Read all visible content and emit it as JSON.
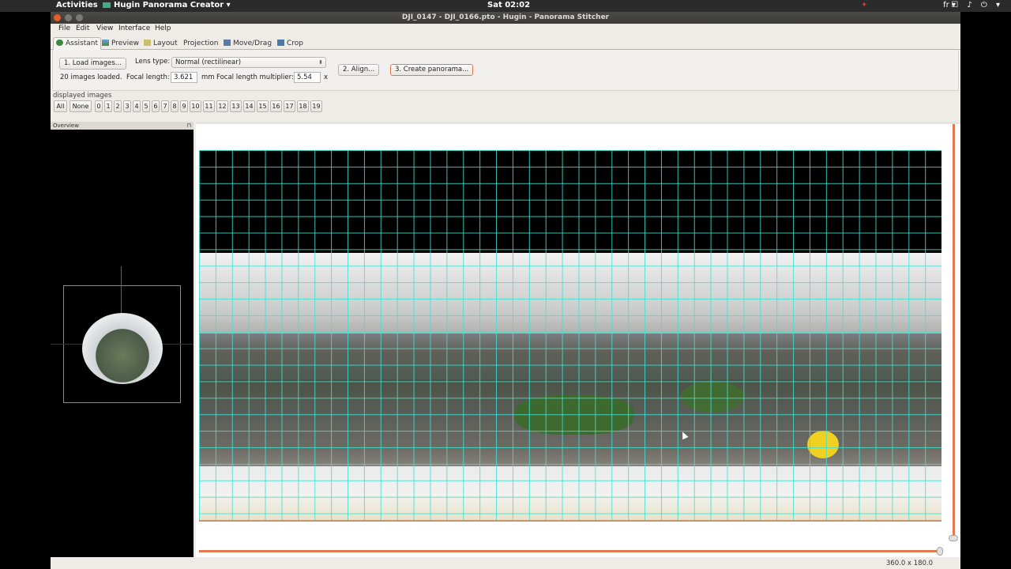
{
  "topbar": {
    "activities": "Activities",
    "app_name": "Hugin Panorama Creator",
    "clock": "Sat 02:02",
    "keyboard": "fr"
  },
  "window": {
    "title": "DJI_0147 - DJI_0166.pto - Hugin - Panorama Stitcher"
  },
  "menu": [
    "File",
    "Edit",
    "View",
    "Interface",
    "Help"
  ],
  "tabs": [
    "Assistant",
    "Preview",
    "Layout",
    "Projection",
    "Move/Drag",
    "Crop"
  ],
  "assistant": {
    "load_button": "1. Load images...",
    "images_loaded": "20 images loaded.",
    "lens_type_label": "Lens type:",
    "lens_type_value": "Normal (rectilinear)",
    "focal_length_label": "Focal length:",
    "focal_length_value": "3.621",
    "focal_length_unit": "mm",
    "multiplier_label": "Focal length multiplier:",
    "multiplier_value": "5.54",
    "multiplier_unit": "x",
    "align_button": "2. Align...",
    "create_button": "3. Create panorama..."
  },
  "displayed_images": {
    "label": "displayed images",
    "all": "All",
    "none": "None",
    "numbers": [
      "0",
      "1",
      "2",
      "3",
      "4",
      "5",
      "6",
      "7",
      "8",
      "9",
      "10",
      "11",
      "12",
      "13",
      "14",
      "15",
      "16",
      "17",
      "18",
      "19"
    ]
  },
  "overview": {
    "title": "Overview",
    "pin": "⊓"
  },
  "status": {
    "fov": "360.0 x 180.0"
  },
  "colors": {
    "accent": "#e07a4e",
    "grid": "#40e0d0"
  }
}
